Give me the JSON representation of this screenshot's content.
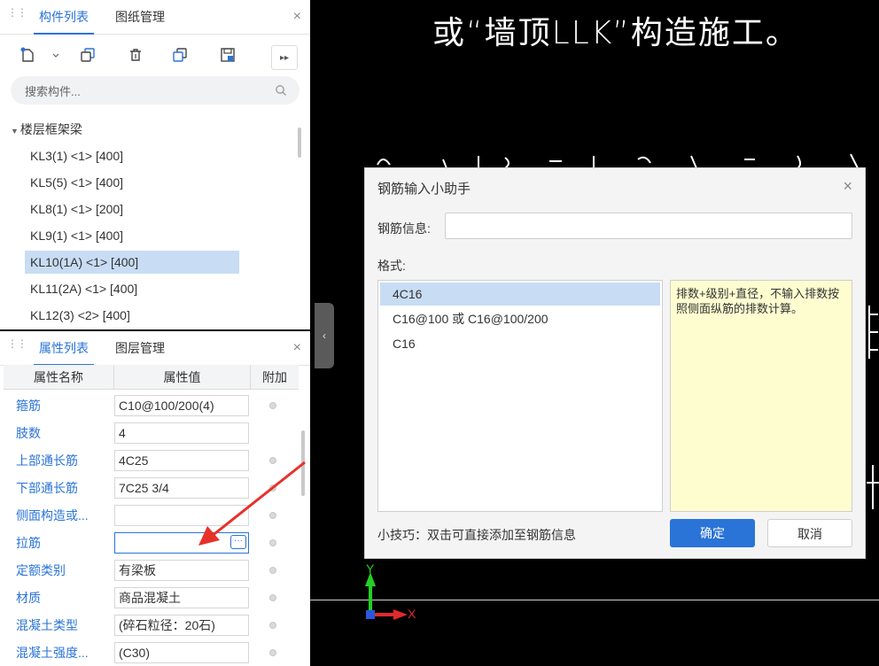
{
  "component_panel": {
    "tabs": [
      "构件列表",
      "图纸管理"
    ],
    "close": "×",
    "search_placeholder": "搜索构件...",
    "group": "楼层框架梁",
    "items": [
      "KL3(1) <1> [400]",
      "KL5(5) <1> [400]",
      "KL8(1) <1> [200]",
      "KL9(1) <1> [400]",
      "KL10(1A) <1> [400]",
      "KL11(2A) <1> [400]",
      "KL12(3) <2> [400]"
    ],
    "selected_index": 4,
    "more": "▸▸"
  },
  "property_panel": {
    "tabs": [
      "属性列表",
      "图层管理"
    ],
    "close": "×",
    "headers": [
      "属性名称",
      "属性值",
      "附加"
    ],
    "rows": [
      {
        "name": "箍筋",
        "value": "C10@100/200(4)",
        "dot": true
      },
      {
        "name": "肢数",
        "value": "4",
        "dot": false
      },
      {
        "name": "上部通长筋",
        "value": "4C25",
        "dot": true
      },
      {
        "name": "下部通长筋",
        "value": "7C25 3/4",
        "dot": true
      },
      {
        "name": "侧面构造或...",
        "value": "",
        "dot": true
      },
      {
        "name": "拉筋",
        "value": "",
        "dot": true
      },
      {
        "name": "定额类别",
        "value": "有梁板",
        "dot": true
      },
      {
        "name": "材质",
        "value": "商品混凝土",
        "dot": true
      },
      {
        "name": "混凝土类型",
        "value": "(碎石粒径：20石)",
        "dot": true
      },
      {
        "name": "混凝土强度...",
        "value": "(C30)",
        "dot": true
      }
    ],
    "more_button": "···"
  },
  "cad": {
    "line1": "或“墙顶LLK”构造施工。",
    "axis_y": "Y",
    "axis_x": "X"
  },
  "dialog": {
    "title": "钢筋输入小助手",
    "close": "×",
    "info_label": "钢筋信息:",
    "info_value": "",
    "format_label": "格式:",
    "formats": [
      "4C16",
      "C16@100 或 C16@100/200",
      "C16"
    ],
    "selected_format": 0,
    "description": "排数+级别+直径，不输入排数按照侧面纵筋的排数计算。",
    "tip": "小技巧：双击可直接添加至钢筋信息",
    "ok": "确定",
    "cancel": "取消"
  },
  "colors": {
    "accent": "#2a74d8",
    "selected": "#c8dcf4",
    "arrow": "#e8302a"
  }
}
